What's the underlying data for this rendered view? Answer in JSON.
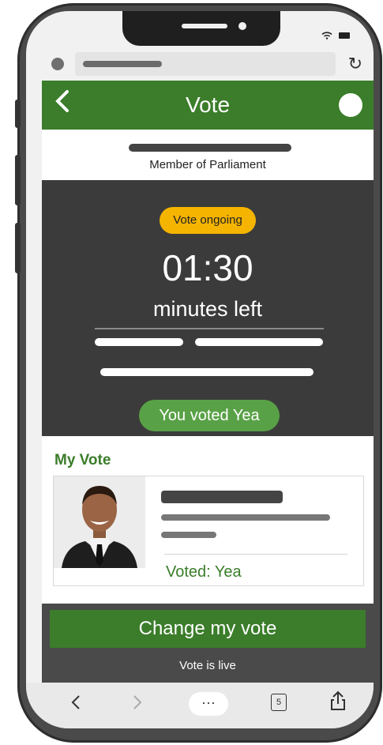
{
  "header": {
    "title": "Vote"
  },
  "member": {
    "role": "Member of Parliament"
  },
  "vote_status": {
    "badge": "Vote ongoing",
    "timer": "01:30",
    "timer_unit": "minutes left",
    "my_choice": "You voted Yea"
  },
  "my_vote": {
    "title": "My Vote",
    "voted_label": "Voted: Yea"
  },
  "actions": {
    "change_vote": "Change my vote",
    "status": "Vote is live"
  },
  "toolbar": {
    "more": "···",
    "tab_count": "5"
  },
  "colors": {
    "brand_green": "#3b7d2a",
    "pill_green": "#59a146",
    "badge_yellow": "#f5b400",
    "panel_dark": "#3b3b3b"
  },
  "icons": [
    "back-chevron-icon",
    "reload-icon",
    "wifi-icon",
    "battery-icon",
    "share-icon",
    "tabs-icon",
    "forward-icon"
  ]
}
